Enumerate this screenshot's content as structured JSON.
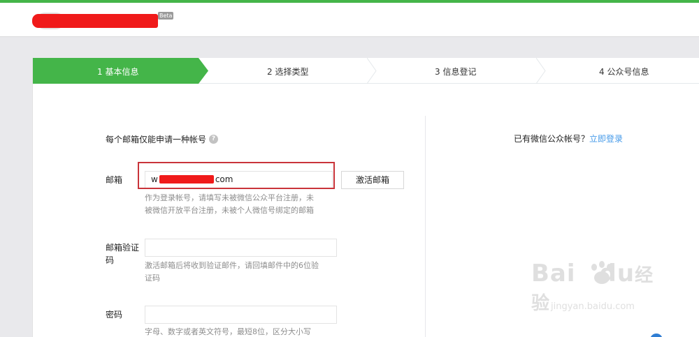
{
  "header": {
    "beta_badge": "Beta"
  },
  "steps": [
    {
      "label": "1 基本信息",
      "active": true
    },
    {
      "label": "2 选择类型",
      "active": false
    },
    {
      "label": "3 信息登记",
      "active": false
    },
    {
      "label": "4 公众号信息",
      "active": false
    }
  ],
  "form": {
    "intro": "每个邮箱仅能申请一种帐号",
    "email": {
      "label": "邮箱",
      "value_prefix": "w",
      "value_suffix": "com",
      "activate_button": "激活邮箱",
      "help_line1": "作为登录帐号，请填写未被微信公众平台注册，未",
      "help_line2": "被微信开放平台注册，未被个人微信号绑定的邮箱"
    },
    "code": {
      "label_line1": "邮箱验证",
      "label_line2": "码",
      "value": "",
      "help_line1": "激活邮箱后将收到验证邮件，请回填邮件中的6位验",
      "help_line2": "证码"
    },
    "password": {
      "label": "密码",
      "value": "",
      "help": "字母、数字或者英文符号，最短8位，区分大小写"
    }
  },
  "side": {
    "question": "已有微信公众帐号？",
    "login_link": "立即登录"
  },
  "watermark": {
    "brand_a": "Bai",
    "brand_b": "du",
    "brand_c": "经验",
    "url": "jingyan.baidu.com"
  },
  "colors": {
    "accent_green": "#44b549",
    "link_blue": "#459ae9",
    "highlight_red": "#c9343a"
  }
}
